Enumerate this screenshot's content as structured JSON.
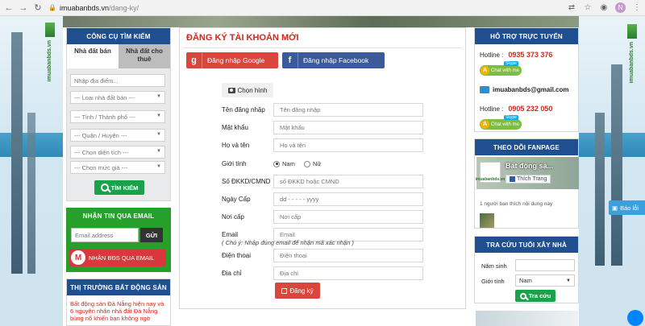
{
  "browser": {
    "url_domain": "imuabanbds.vn",
    "url_path": "/dang-ky/",
    "profile_initial": "N"
  },
  "side_logo": "imuabanbds.vn",
  "search": {
    "header": "CÔNG CỤ TÌM KIẾM",
    "tabs": [
      "Nhà đất bán",
      "Nhà đất cho thuê"
    ],
    "location_placeholder": "Nhập địa điểm...",
    "selects": [
      "--- Loại nhà đất bán ---",
      "--- Tỉnh / Thành phố ---",
      "--- Quận / Huyện ---",
      "--- Chọn diện tích ---",
      "--- Chọn mức giá ---"
    ],
    "button": "TÌM KIẾM"
  },
  "newsletter": {
    "header": "NHẬN TIN QUA EMAIL",
    "email_placeholder": "Email address",
    "submit": "GỬI",
    "bds_button": "NHẬN BĐS QUA EMAIL"
  },
  "market": {
    "header": "THỊ TRƯỜNG BẤT ĐỘNG SẢN",
    "headline": "Bất động sản Đà Nẵng hiện nay và 6 nguyên nhân nhà đất Đà Nẵng bùng nổ khiến bạn không ngờ"
  },
  "form": {
    "title": "ĐĂNG KÝ TÀI KHOẢN MỚI",
    "google_login": "Đăng nhập Google",
    "facebook_login": "Đăng nhập Facebook",
    "choose_image": "Chọn hình",
    "fields": {
      "username": {
        "label": "Tên đăng nhập",
        "placeholder": "Tên đăng nhập"
      },
      "password": {
        "label": "Mật khẩu",
        "placeholder": "Mật khẩu"
      },
      "fullname": {
        "label": "Họ và tên",
        "placeholder": "Họ và tên"
      },
      "gender": {
        "label": "Giới tính",
        "male": "Nam",
        "female": "Nữ"
      },
      "idcard": {
        "label": "Số ĐKKD/CMND",
        "placeholder": "số ĐKKD hoặc CMND"
      },
      "issue_date": {
        "label": "Ngày Cấp",
        "placeholder": "dd - - - - - yyyy"
      },
      "issue_place": {
        "label": "Nơi cấp",
        "placeholder": "Nơi cấp"
      },
      "email": {
        "label": "Email",
        "placeholder": "Email"
      },
      "phone": {
        "label": "Điện thoại",
        "placeholder": "Điện thoại"
      },
      "address": {
        "label": "Địa chỉ",
        "placeholder": "Địa chỉ"
      }
    },
    "email_note": "( Chú ý: Nhập đúng email để nhận mã xác nhận )",
    "submit": "Đăng ký"
  },
  "support": {
    "header": "HỖ TRỢ TRỰC TUYẾN",
    "hotline_label": "Hotline :",
    "hotline1": "0935 373 376",
    "hotline2": "0905 232 050",
    "chat": "Chat with me",
    "skype": "Skype",
    "email": "imuabanbds@gmail.com"
  },
  "fanpage": {
    "header": "THEO DÕI FANPAGE",
    "page_name": "Bất động sả...",
    "like": "Thích Trang",
    "logo_text": "imuabanbds.vn",
    "count_text": "1 người bạn thích nội dung này"
  },
  "age_lookup": {
    "header": "TRA CỨU TUỔI XÂY NHÀ",
    "birth_label": "Năm sinh",
    "gender_label": "Giới tính",
    "gender_value": "Nam",
    "button": "Tra cứu"
  },
  "report": "Báo lỗi"
}
